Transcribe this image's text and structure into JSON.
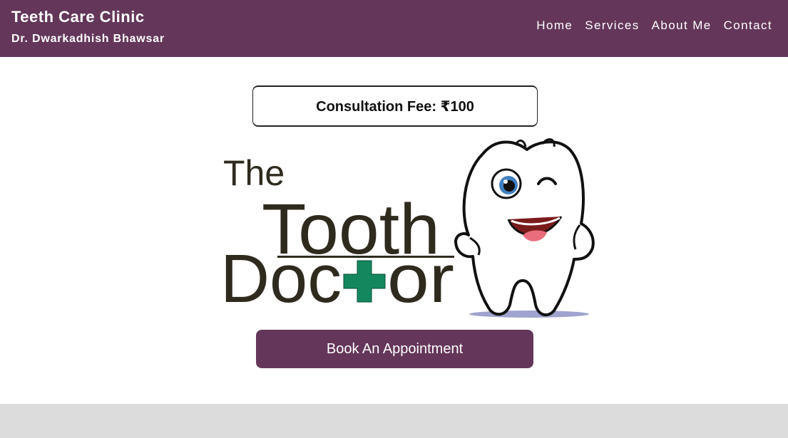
{
  "header": {
    "title": "Teeth Care Clinic",
    "subtitle": "Dr. Dwarkadhish Bhawsar",
    "nav": [
      "Home",
      "Services",
      "About Me",
      "Contact"
    ]
  },
  "fee": {
    "label": "Consultation Fee: ₹100"
  },
  "logo": {
    "line1": "The",
    "line2": "Tooth",
    "line3_prefix": "Doc",
    "line3_suffix": "or"
  },
  "cta": {
    "label": "Book An Appointment"
  },
  "colors": {
    "brand": "#64365a",
    "footer": "#dcdcdc",
    "cross": "#14875e"
  }
}
